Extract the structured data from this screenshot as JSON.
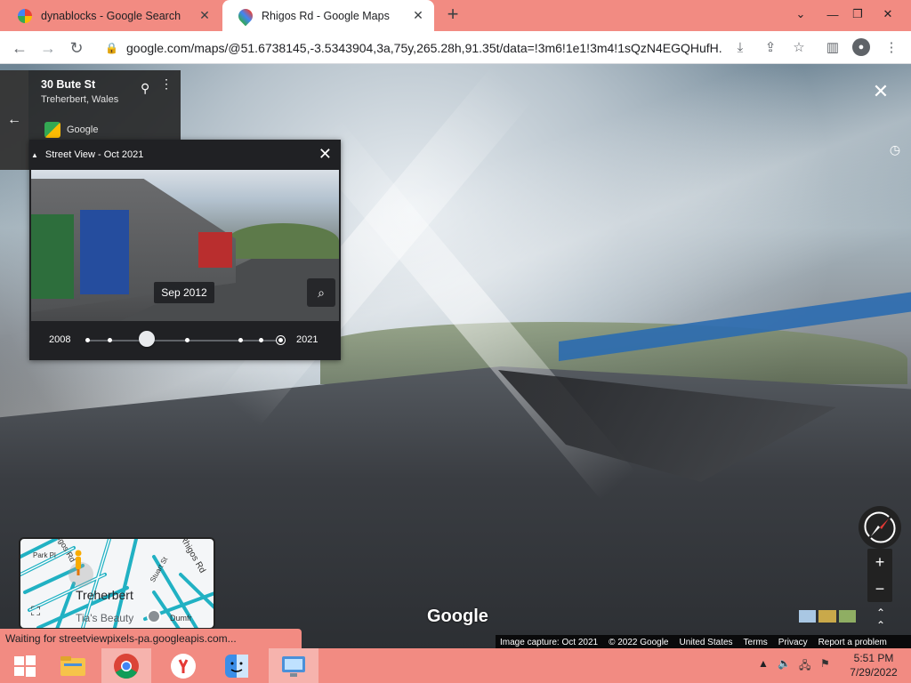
{
  "browser": {
    "tabs": [
      {
        "label": "dynablocks - Google Search",
        "icon": "google-icon"
      },
      {
        "label": "Rhigos Rd - Google Maps",
        "icon": "maps-icon",
        "active": true
      }
    ],
    "url": "google.com/maps/@51.6738145,-3.5343904,3a,75y,265.28h,91.35t/data=!3m6!1e1!3m4!1sQzN4EGQHufH..."
  },
  "location_card": {
    "street": "30 Bute St",
    "city": "Treherbert, Wales",
    "provider": "Google"
  },
  "time_machine": {
    "title": "Street View - Oct 2021",
    "selected_date": "Sep 2012",
    "start_year": "2008",
    "end_year": "2021",
    "selected_fraction": 0.31
  },
  "minimap": {
    "town": "Treherbert",
    "place": "Tia's Beauty",
    "road_labels": [
      "Rhigos Rd",
      "Rhigos Rd",
      "Stuart St",
      "Park Pl",
      "Dumfr"
    ]
  },
  "watermark": "Google",
  "footer": {
    "capture": "Image capture: Oct 2021",
    "copyright": "© 2022 Google",
    "region": "United States",
    "terms": "Terms",
    "privacy": "Privacy",
    "report": "Report a problem"
  },
  "status_bar": "Waiting for streetviewpixels-pa.googleapis.com...",
  "taskbar": {
    "time": "5:51 PM",
    "date": "7/29/2022"
  }
}
